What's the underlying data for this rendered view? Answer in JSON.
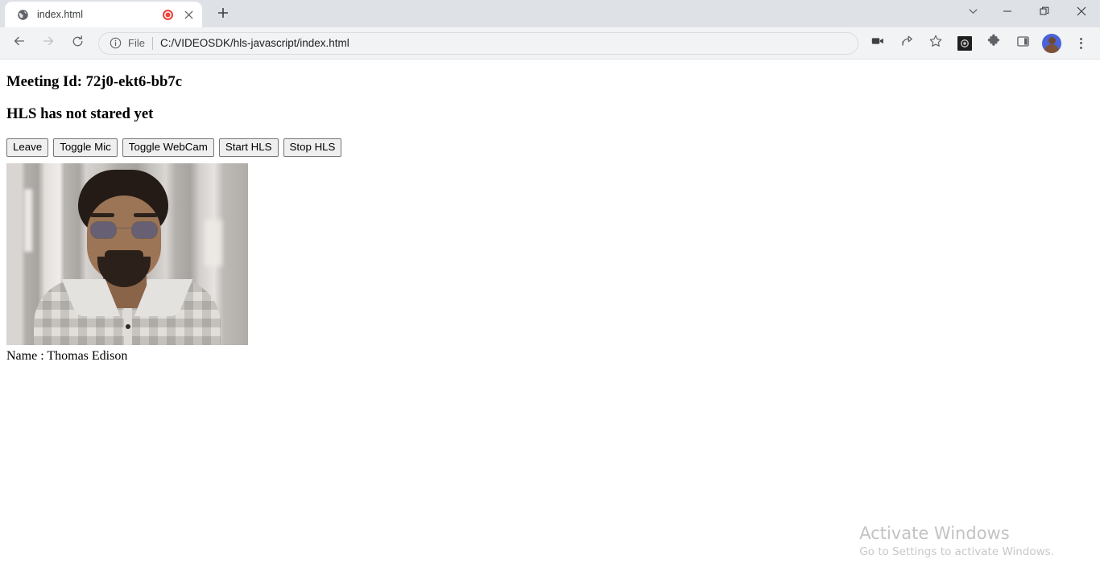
{
  "browser": {
    "tab": {
      "title": "index.html",
      "favicon_icon": "globe-icon",
      "media_indicator_icon": "recording-dot-icon",
      "close_icon": "close-icon"
    },
    "newtab_icon": "plus-icon",
    "window_controls": {
      "tab_search_icon": "chevron-down-icon",
      "minimize_icon": "minimize-icon",
      "maximize_icon": "restore-icon",
      "close_icon": "close-icon"
    },
    "nav": {
      "back_icon": "arrow-left-icon",
      "forward_icon": "arrow-right-icon",
      "reload_icon": "reload-icon"
    },
    "omnibox": {
      "info_icon": "info-circle-icon",
      "scheme_label": "File",
      "url": "C:/VIDEOSDK/hls-javascript/index.html"
    },
    "toolbar_right": {
      "media_cast_icon": "video-camera-icon",
      "share_icon": "share-icon",
      "bookmark_icon": "star-icon",
      "extension_recorder_icon": "screen-recorder-icon",
      "extensions_icon": "puzzle-piece-icon",
      "side_panel_icon": "side-panel-icon",
      "profile_icon": "avatar-icon",
      "menu_icon": "three-dots-icon"
    }
  },
  "page": {
    "meeting_heading": "Meeting Id: 72j0-ekt6-bb7c",
    "hls_status_heading": "HLS has not stared yet",
    "buttons": [
      {
        "label": "Leave",
        "name": "leave-button"
      },
      {
        "label": "Toggle Mic",
        "name": "toggle-mic-button"
      },
      {
        "label": "Toggle WebCam",
        "name": "toggle-webcam-button"
      },
      {
        "label": "Start HLS",
        "name": "start-hls-button"
      },
      {
        "label": "Stop HLS",
        "name": "stop-hls-button"
      }
    ],
    "participant": {
      "video_label": "participant-video-stream",
      "name_text": "Name : Thomas Edison"
    }
  },
  "watermark": {
    "title": "Activate Windows",
    "subtitle": "Go to Settings to activate Windows."
  },
  "colors": {
    "tabstrip_bg": "#dee1e6",
    "toolbar_bg": "#f1f3f4",
    "tab_active_bg": "#ffffff",
    "recording_red": "#e8453c",
    "avatar_blue": "#4a63d8",
    "page_bg": "#ffffff",
    "button_bg": "#efefef",
    "button_border": "#767676",
    "watermark_gray": "#c3c3c3"
  }
}
